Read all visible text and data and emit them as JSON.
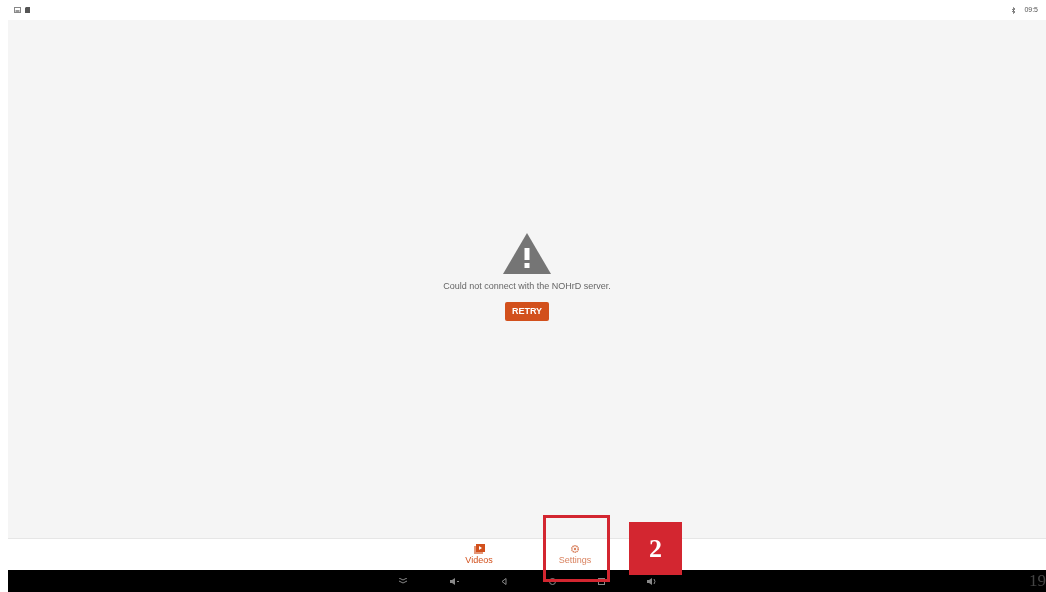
{
  "status_bar": {
    "time": "09:5"
  },
  "error": {
    "message": "Could not connect with the NOHrD server.",
    "retry_button": "RETRY"
  },
  "bottom_nav": [
    {
      "label": "Videos",
      "selected": true,
      "kind": "videos"
    },
    {
      "label": "Settings",
      "selected": false,
      "kind": "settings"
    }
  ],
  "annotation": {
    "number": "2"
  },
  "page_number": "19"
}
